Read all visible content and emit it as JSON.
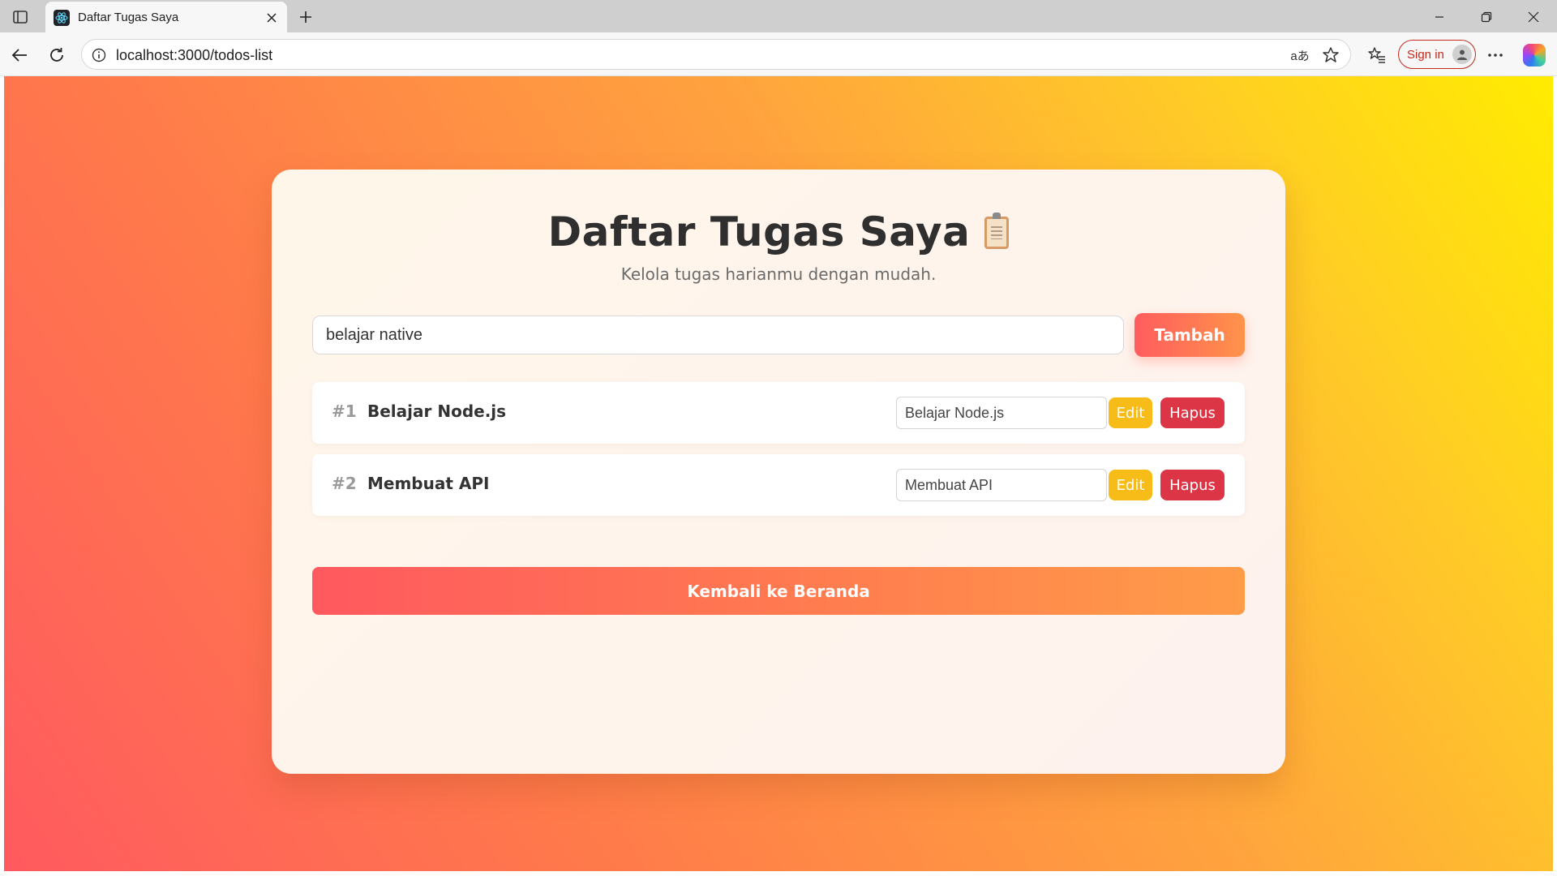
{
  "browser": {
    "tab_title": "Daftar Tugas Saya",
    "url": "localhost:3000/todos-list",
    "read_aloud_label": "aあ",
    "signin_label": "Sign in",
    "icons": [
      "sidebar-toggle-icon",
      "react-favicon-icon",
      "close-tab-icon",
      "new-tab-icon",
      "minimize-icon",
      "restore-icon",
      "close-window-icon",
      "back-icon",
      "refresh-icon",
      "site-info-icon",
      "favorite-star-icon",
      "favorites-icon",
      "profile-avatar-icon",
      "more-menu-icon",
      "copilot-icon"
    ]
  },
  "page": {
    "title": "Daftar Tugas Saya",
    "title_icon": "clipboard-icon",
    "subtitle": "Kelola tugas harianmu dengan mudah.",
    "new_task_value": "belajar native",
    "add_button": "Tambah",
    "tasks": [
      {
        "number": "#1",
        "text": "Belajar Node.js",
        "edit_value": "Belajar Node.js",
        "edit_label": "Edit",
        "delete_label": "Hapus"
      },
      {
        "number": "#2",
        "text": "Membuat API",
        "edit_value": "Membuat API",
        "edit_label": "Edit",
        "delete_label": "Hapus"
      }
    ],
    "home_button": "Kembali ke Beranda"
  },
  "colors": {
    "gradient_start": "#ff5a5f",
    "gradient_end": "#ffec00",
    "edit_button": "#f7bc17",
    "delete_button": "#dc3545",
    "accent": "#ff7950"
  }
}
